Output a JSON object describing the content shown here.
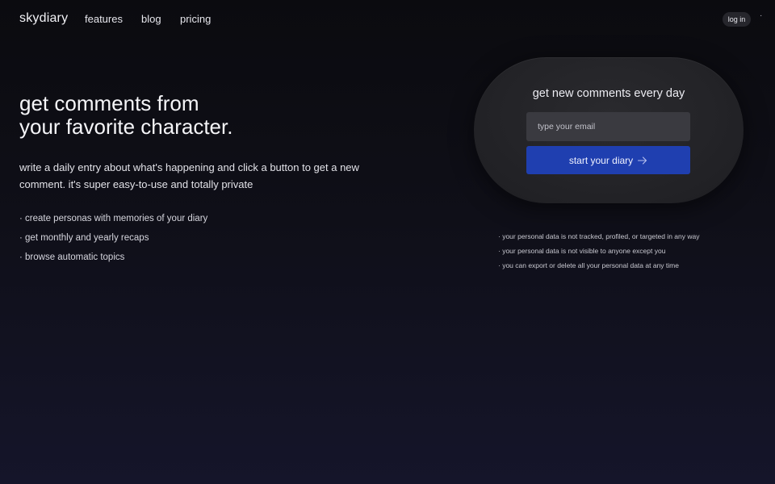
{
  "nav": {
    "brand": "skydiary",
    "links": [
      "features",
      "blog",
      "pricing"
    ],
    "login_label": "log in",
    "menu_glyph": "·"
  },
  "hero": {
    "title_lines": [
      "get comments from",
      "your favorite character."
    ],
    "description": "write a daily entry about what's happening and click a button to get a new comment. it's super easy-to-use and totally private",
    "features": [
      "· create personas with memories of your diary",
      "· get monthly and yearly recaps",
      "· browse automatic topics"
    ]
  },
  "signup": {
    "title": "get new comments every day",
    "email_placeholder": "type your email",
    "email_value": "",
    "button_label": "start your diary",
    "button_icon": "arrow-right-icon"
  },
  "privacy": [
    "· your personal data is not tracked, profiled, or targeted in any way",
    "· your personal data is not visible to anyone except you",
    "· you can export or delete all your personal data at any time"
  ],
  "colors": {
    "background_top": "#0b0b0f",
    "background_bottom": "#15152a",
    "card": "#232327",
    "input": "#3a3a40",
    "accent": "#1f3fb0"
  }
}
